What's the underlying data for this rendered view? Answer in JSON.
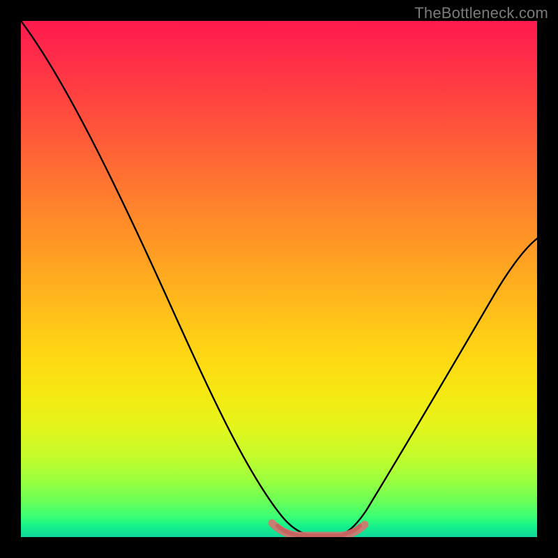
{
  "watermark": "TheBottleneck.com",
  "chart_data": {
    "type": "line",
    "title": "",
    "xlabel": "",
    "ylabel": "",
    "xlim": [
      0,
      100
    ],
    "ylim": [
      0,
      100
    ],
    "series": [
      {
        "name": "bottleneck-curve",
        "x": [
          0,
          5,
          10,
          15,
          20,
          25,
          30,
          35,
          40,
          43,
          47,
          50,
          53,
          55,
          58,
          60,
          62,
          65,
          70,
          75,
          80,
          85,
          90,
          95,
          100
        ],
        "y": [
          100,
          94,
          87,
          79,
          70,
          61,
          51,
          41,
          30,
          22,
          12,
          5,
          1,
          0,
          0,
          0,
          1,
          4,
          11,
          19,
          27,
          35,
          43,
          50,
          58
        ]
      },
      {
        "name": "optimum-band",
        "x": [
          50,
          52,
          54,
          56,
          58,
          60,
          62
        ],
        "y": [
          2.5,
          1.2,
          0.6,
          0.4,
          0.6,
          1.2,
          2.5
        ]
      }
    ],
    "gradient_stops": [
      {
        "pos": 0,
        "color": "#ff1a4d"
      },
      {
        "pos": 50,
        "color": "#ffb81c"
      },
      {
        "pos": 80,
        "color": "#e6f41a"
      },
      {
        "pos": 100,
        "color": "#0fd79a"
      }
    ]
  }
}
